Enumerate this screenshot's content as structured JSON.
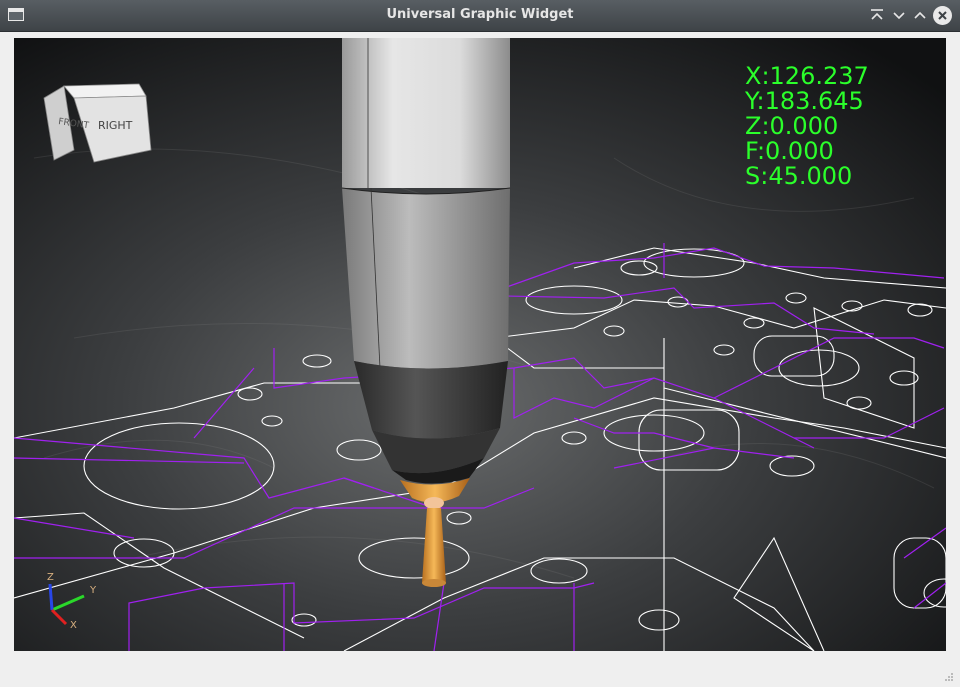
{
  "window": {
    "title": "Universal Graphic Widget"
  },
  "view_cube": {
    "face_front_label": "RIGHT",
    "face_side_label": "FRONT"
  },
  "dro": [
    {
      "axis": "X:",
      "value": "126.237"
    },
    {
      "axis": "Y:",
      "value": "183.645"
    },
    {
      "axis": "Z:",
      "value": "0.000"
    },
    {
      "axis": "F:",
      "value": "0.000"
    },
    {
      "axis": "S:",
      "value": "45.000"
    }
  ],
  "axis_triad": {
    "x_label": "X",
    "y_label": "Y",
    "z_label": "Z"
  },
  "colors": {
    "dro_text": "#2bff2b",
    "toolpath": "#a020f0",
    "geometry": "#ffffff",
    "tool_tip": "#e8a030"
  },
  "icons": {
    "minimize": "keep-above-icon",
    "shade": "chevron-down-icon",
    "maximize": "chevron-up-icon",
    "close": "close-icon"
  }
}
